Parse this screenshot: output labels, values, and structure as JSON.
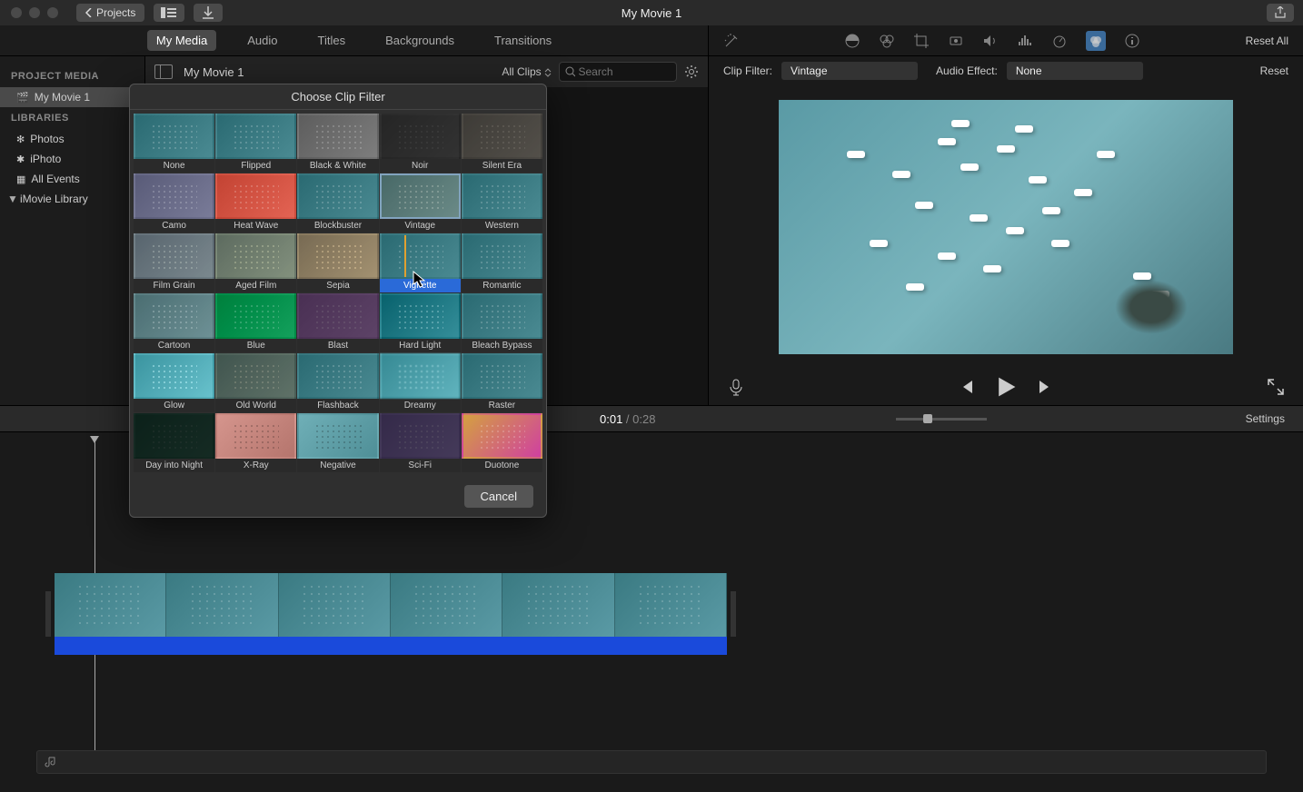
{
  "titlebar": {
    "back_label": "Projects",
    "title": "My Movie 1"
  },
  "tabs": {
    "my_media": "My Media",
    "audio": "Audio",
    "titles": "Titles",
    "backgrounds": "Backgrounds",
    "transitions": "Transitions"
  },
  "browser": {
    "breadcrumb": "My Movie 1",
    "all_clips": "All Clips",
    "search_placeholder": "Search"
  },
  "sidebar": {
    "section_project": "PROJECT MEDIA",
    "project_item": "My Movie 1",
    "section_libraries": "LIBRARIES",
    "items": {
      "photos": "Photos",
      "iphoto": "iPhoto",
      "all_events": "All Events",
      "imovie_library": "iMovie Library"
    }
  },
  "inspector": {
    "reset_all": "Reset All",
    "clip_filter_label": "Clip Filter:",
    "clip_filter_value": "Vintage",
    "audio_effect_label": "Audio Effect:",
    "audio_effect_value": "None",
    "reset": "Reset"
  },
  "timedisplay": {
    "current": "0:01",
    "separator": " / ",
    "total": "0:28"
  },
  "timeline": {
    "settings": "Settings"
  },
  "modal": {
    "title": "Choose Clip Filter",
    "cancel": "Cancel",
    "filters": [
      {
        "name": "None",
        "cls": ""
      },
      {
        "name": "Flipped",
        "cls": ""
      },
      {
        "name": "Black & White",
        "cls": "ft-bw"
      },
      {
        "name": "Noir",
        "cls": "ft-noir"
      },
      {
        "name": "Silent Era",
        "cls": "ft-silent"
      },
      {
        "name": "Camo",
        "cls": "ft-camo"
      },
      {
        "name": "Heat Wave",
        "cls": "ft-heat"
      },
      {
        "name": "Blockbuster",
        "cls": ""
      },
      {
        "name": "Vintage",
        "cls": "ft-vintage",
        "selected": true
      },
      {
        "name": "Western",
        "cls": ""
      },
      {
        "name": "Film Grain",
        "cls": "ft-grain"
      },
      {
        "name": "Aged Film",
        "cls": "ft-aged"
      },
      {
        "name": "Sepia",
        "cls": "ft-sepia"
      },
      {
        "name": "Vignette",
        "cls": "",
        "hover": true
      },
      {
        "name": "Romantic",
        "cls": ""
      },
      {
        "name": "Cartoon",
        "cls": "ft-cartoon"
      },
      {
        "name": "Blue",
        "cls": "ft-blue"
      },
      {
        "name": "Blast",
        "cls": "ft-blast"
      },
      {
        "name": "Hard Light",
        "cls": "ft-hard"
      },
      {
        "name": "Bleach Bypass",
        "cls": ""
      },
      {
        "name": "Glow",
        "cls": "ft-glow"
      },
      {
        "name": "Old World",
        "cls": "ft-old"
      },
      {
        "name": "Flashback",
        "cls": ""
      },
      {
        "name": "Dreamy",
        "cls": "ft-dreamy"
      },
      {
        "name": "Raster",
        "cls": ""
      },
      {
        "name": "Day into Night",
        "cls": "ft-night"
      },
      {
        "name": "X-Ray",
        "cls": "ft-xray"
      },
      {
        "name": "Negative",
        "cls": "ft-neg"
      },
      {
        "name": "Sci-Fi",
        "cls": "ft-scifi"
      },
      {
        "name": "Duotone",
        "cls": "ft-duo"
      }
    ]
  }
}
